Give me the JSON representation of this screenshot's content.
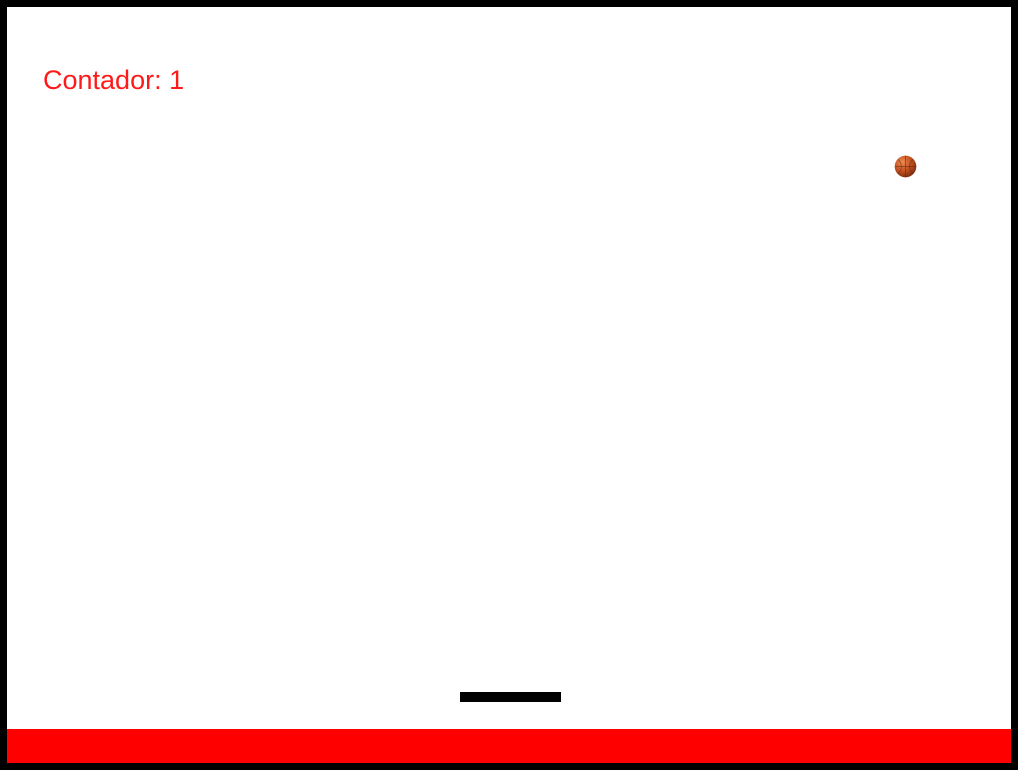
{
  "hud": {
    "counter_text": "Contador: 1",
    "counter_value": 1
  },
  "ball": {
    "icon": "basketball-icon"
  },
  "colors": {
    "frame_border": "#000000",
    "background": "#ffffff",
    "counter_text": "#ff1a1a",
    "paddle": "#000000",
    "floor": "#ff0000",
    "ball_base": "#c2511f",
    "ball_highlight": "#ef8a55",
    "ball_shadow": "#7a2c10"
  }
}
